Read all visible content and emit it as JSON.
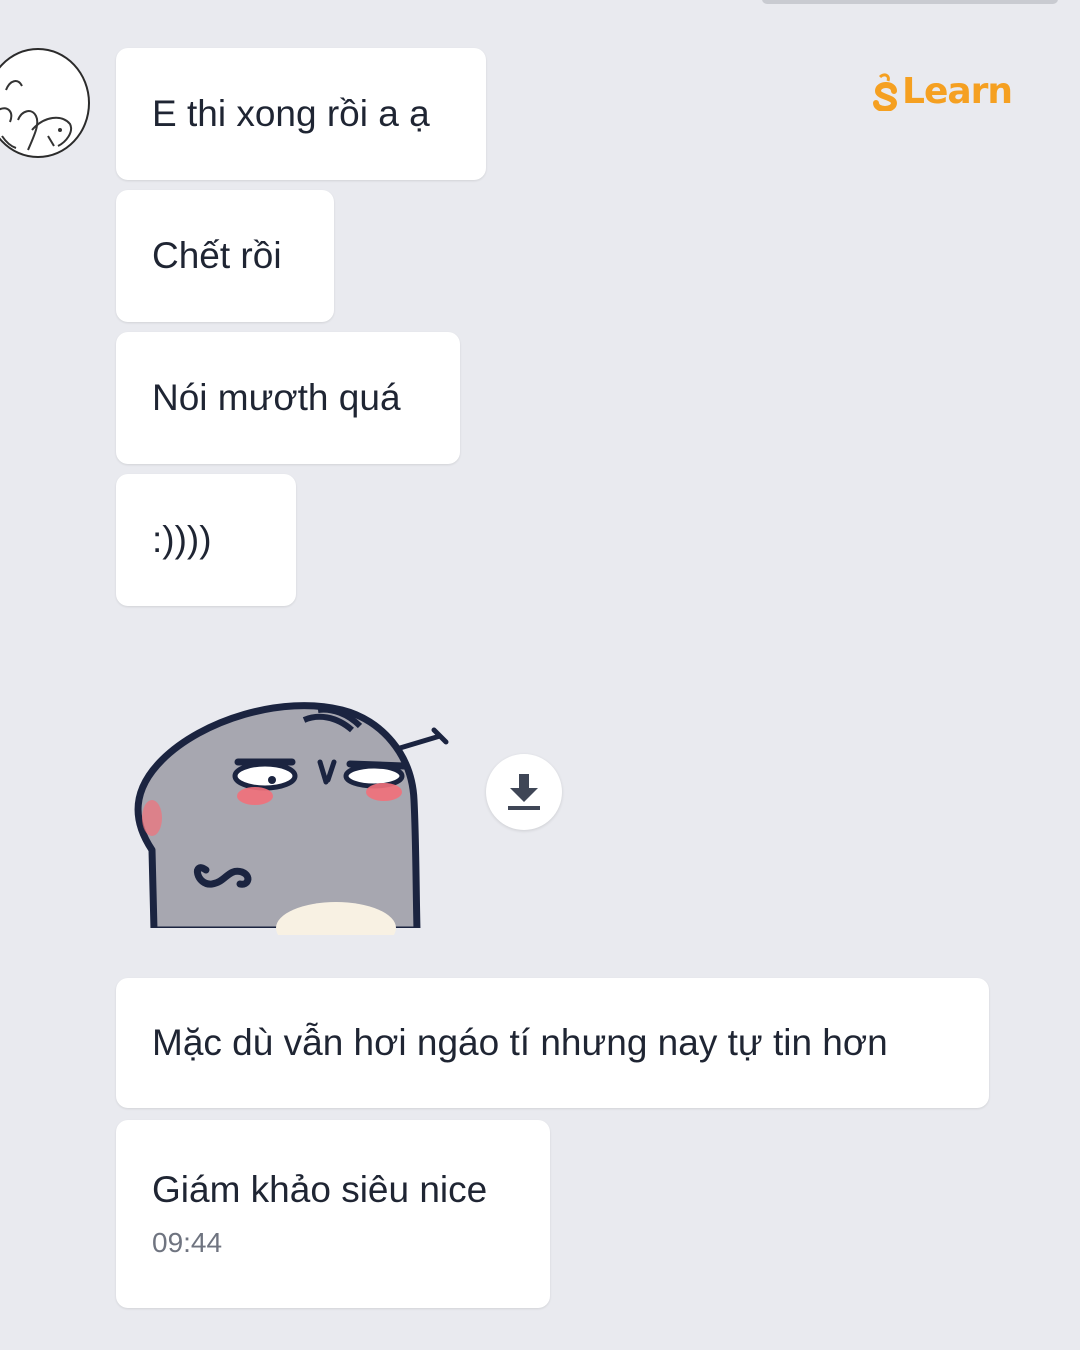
{
  "brand": {
    "logo_text": "Learn",
    "accent": "#f5a021"
  },
  "messages": [
    {
      "text": "E thi xong rồi a ạ"
    },
    {
      "text": "Chết rồi"
    },
    {
      "text": "Nói mươth quá"
    },
    {
      "text": ":))))"
    },
    {
      "text": "Mặc dù vẫn hơi ngáo tí nhưng nay tự tin hơn"
    },
    {
      "text": "Giám khảo siêu nice",
      "time": "09:44"
    }
  ],
  "sticker": {
    "icon": "sticker-grumpy-face"
  },
  "download": {
    "icon": "download-icon"
  },
  "colors": {
    "background": "#e9eaef",
    "bubble": "#ffffff",
    "text": "#1f2533",
    "timestamp": "#6f7480"
  }
}
